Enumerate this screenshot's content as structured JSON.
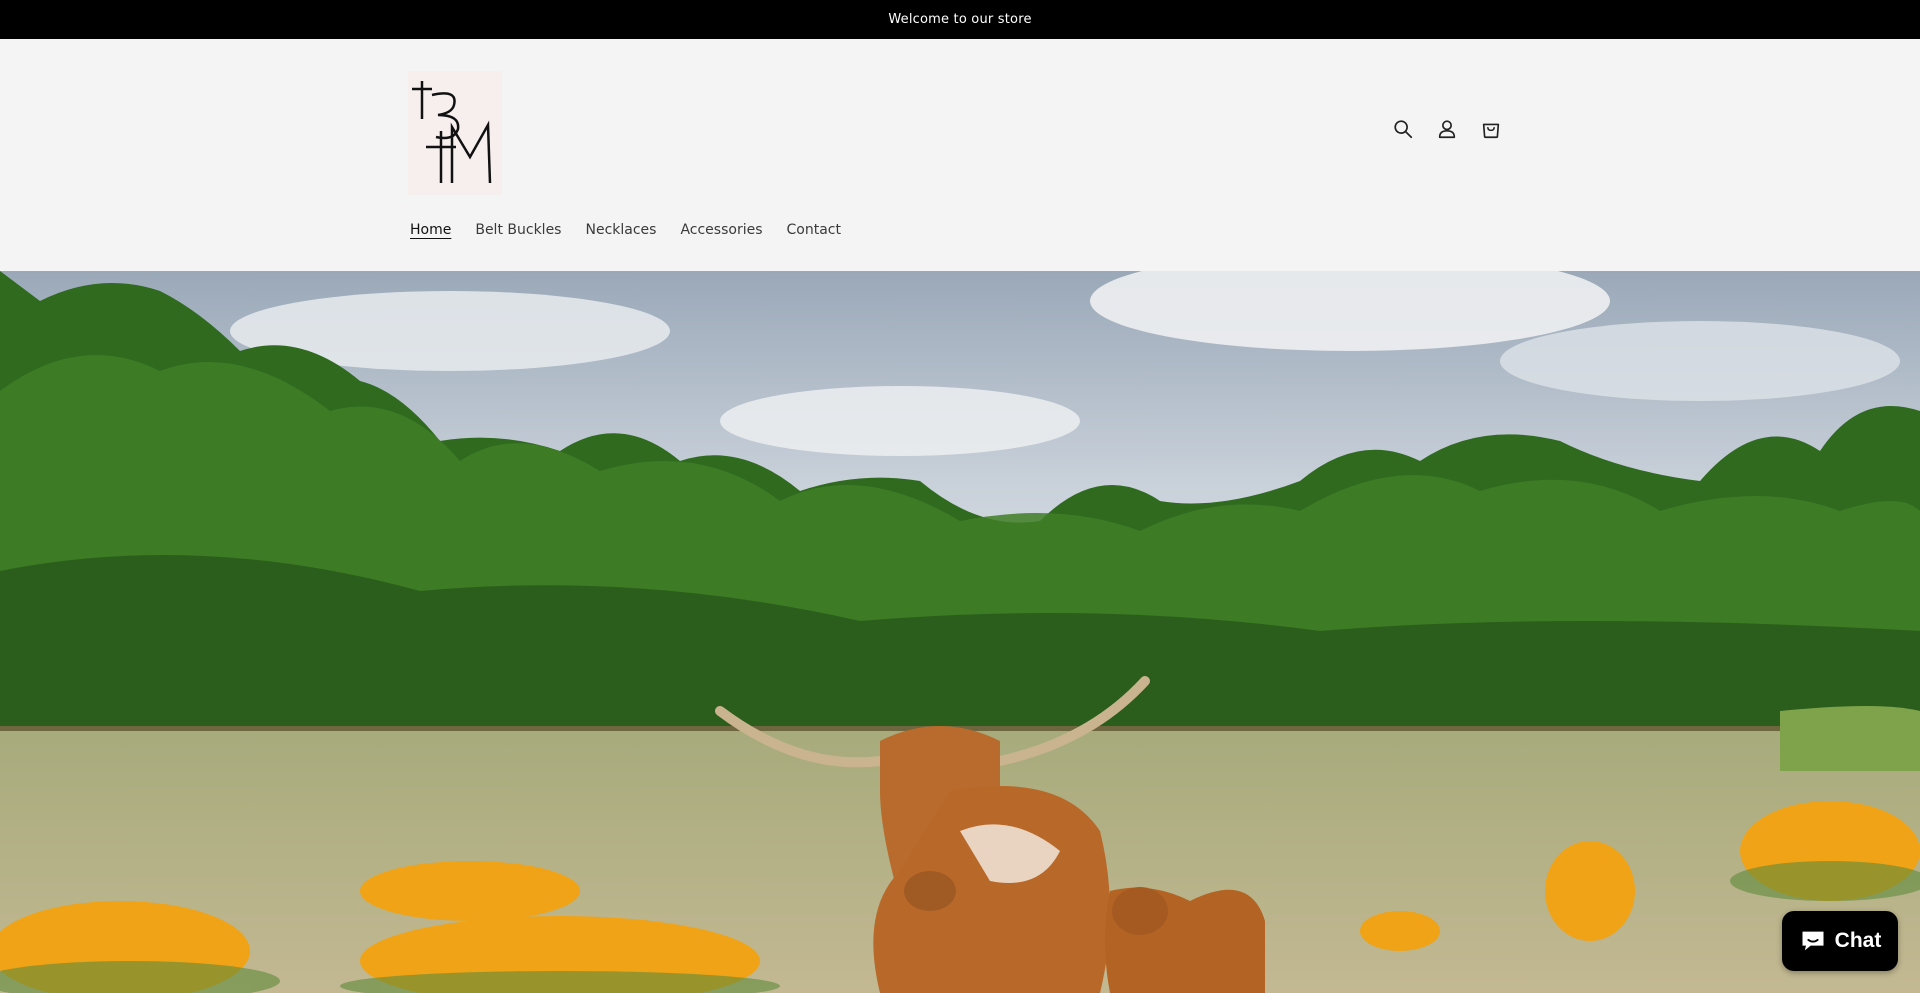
{
  "announcement": {
    "text": "Welcome to our store"
  },
  "header": {
    "logo_alt": "BM logo",
    "icons": [
      "search-icon",
      "account-icon",
      "cart-icon"
    ]
  },
  "nav": {
    "items": [
      {
        "label": "Home",
        "active": true
      },
      {
        "label": "Belt Buckles",
        "active": false
      },
      {
        "label": "Necklaces",
        "active": false
      },
      {
        "label": "Accessories",
        "active": false
      },
      {
        "label": "Contact",
        "active": false
      }
    ]
  },
  "hero": {
    "image_subject": "longhorn cow and calf in a field with yellow wildflowers and trees"
  },
  "chat": {
    "label": "Chat",
    "icon": "chat-bubble-icon"
  },
  "colors": {
    "announcement_bg": "#000000",
    "header_bg": "#f4f4f4",
    "chat_bg": "#000000"
  }
}
